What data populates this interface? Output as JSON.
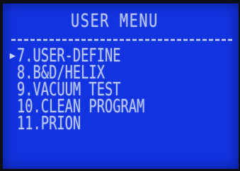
{
  "screen": {
    "title": "USER MENU",
    "cursor_glyph": "▶",
    "selected_index": 0,
    "colors": {
      "lcd_background": "#1233e0",
      "lcd_text": "#b9c6f2",
      "bezel": "#0d0f14"
    }
  },
  "menu": {
    "items": [
      {
        "label": "7.USER-DEFINE"
      },
      {
        "label": "8.B&D/HELIX"
      },
      {
        "label": "9.VACUUM TEST"
      },
      {
        "label": "10.CLEAN PROGRAM"
      },
      {
        "label": "11.PRION"
      }
    ]
  }
}
